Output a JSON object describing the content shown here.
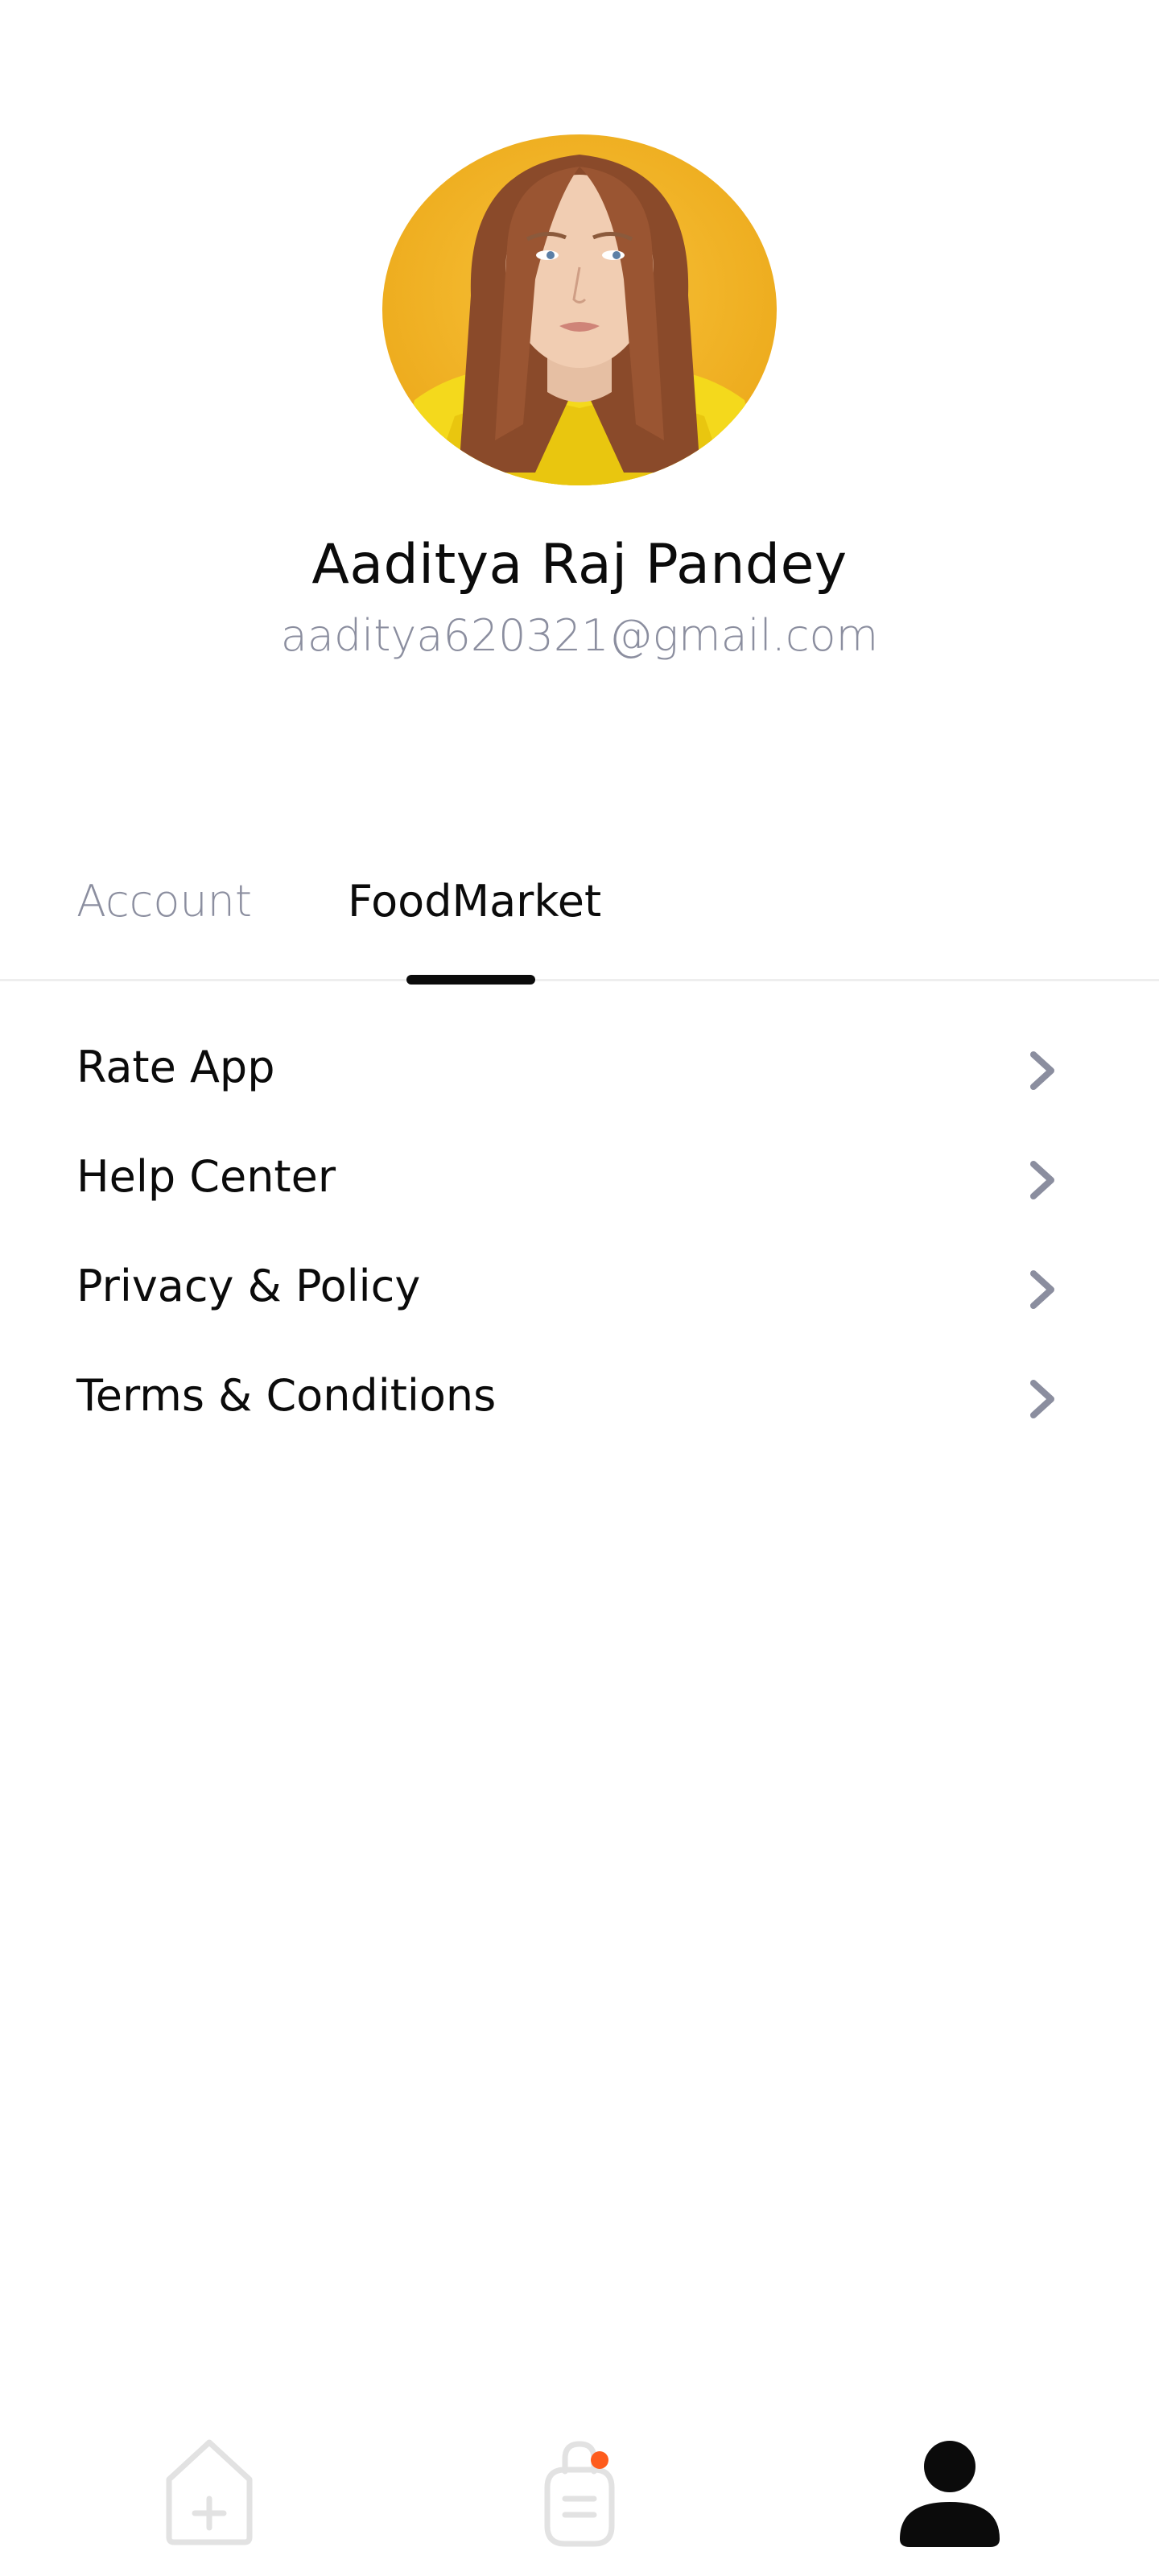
{
  "profile": {
    "name": "Aaditya Raj Pandey",
    "email": "aaditya620321@gmail.com"
  },
  "tabs": [
    {
      "label": "Account",
      "active": false
    },
    {
      "label": "FoodMarket",
      "active": true
    }
  ],
  "menu": [
    {
      "label": "Rate App",
      "icon": "chevron-right-icon"
    },
    {
      "label": "Help Center",
      "icon": "chevron-right-icon"
    },
    {
      "label": "Privacy & Policy",
      "icon": "chevron-right-icon"
    },
    {
      "label": "Terms & Conditions",
      "icon": "chevron-right-icon"
    }
  ],
  "bottom_nav": {
    "items": [
      {
        "name": "home",
        "icon": "home-icon",
        "active": false
      },
      {
        "name": "orders",
        "icon": "shopping-bag-icon",
        "active": false,
        "has_notification": true
      },
      {
        "name": "profile",
        "icon": "user-icon",
        "active": true
      }
    ]
  },
  "colors": {
    "text_primary": "#0b0b0b",
    "text_secondary": "#8b8e9f",
    "avatar_background": "#f0b429",
    "notification_dot": "#fe5c1d",
    "inactive_icon": "#e2e2e2",
    "divider": "#eeeeee"
  }
}
